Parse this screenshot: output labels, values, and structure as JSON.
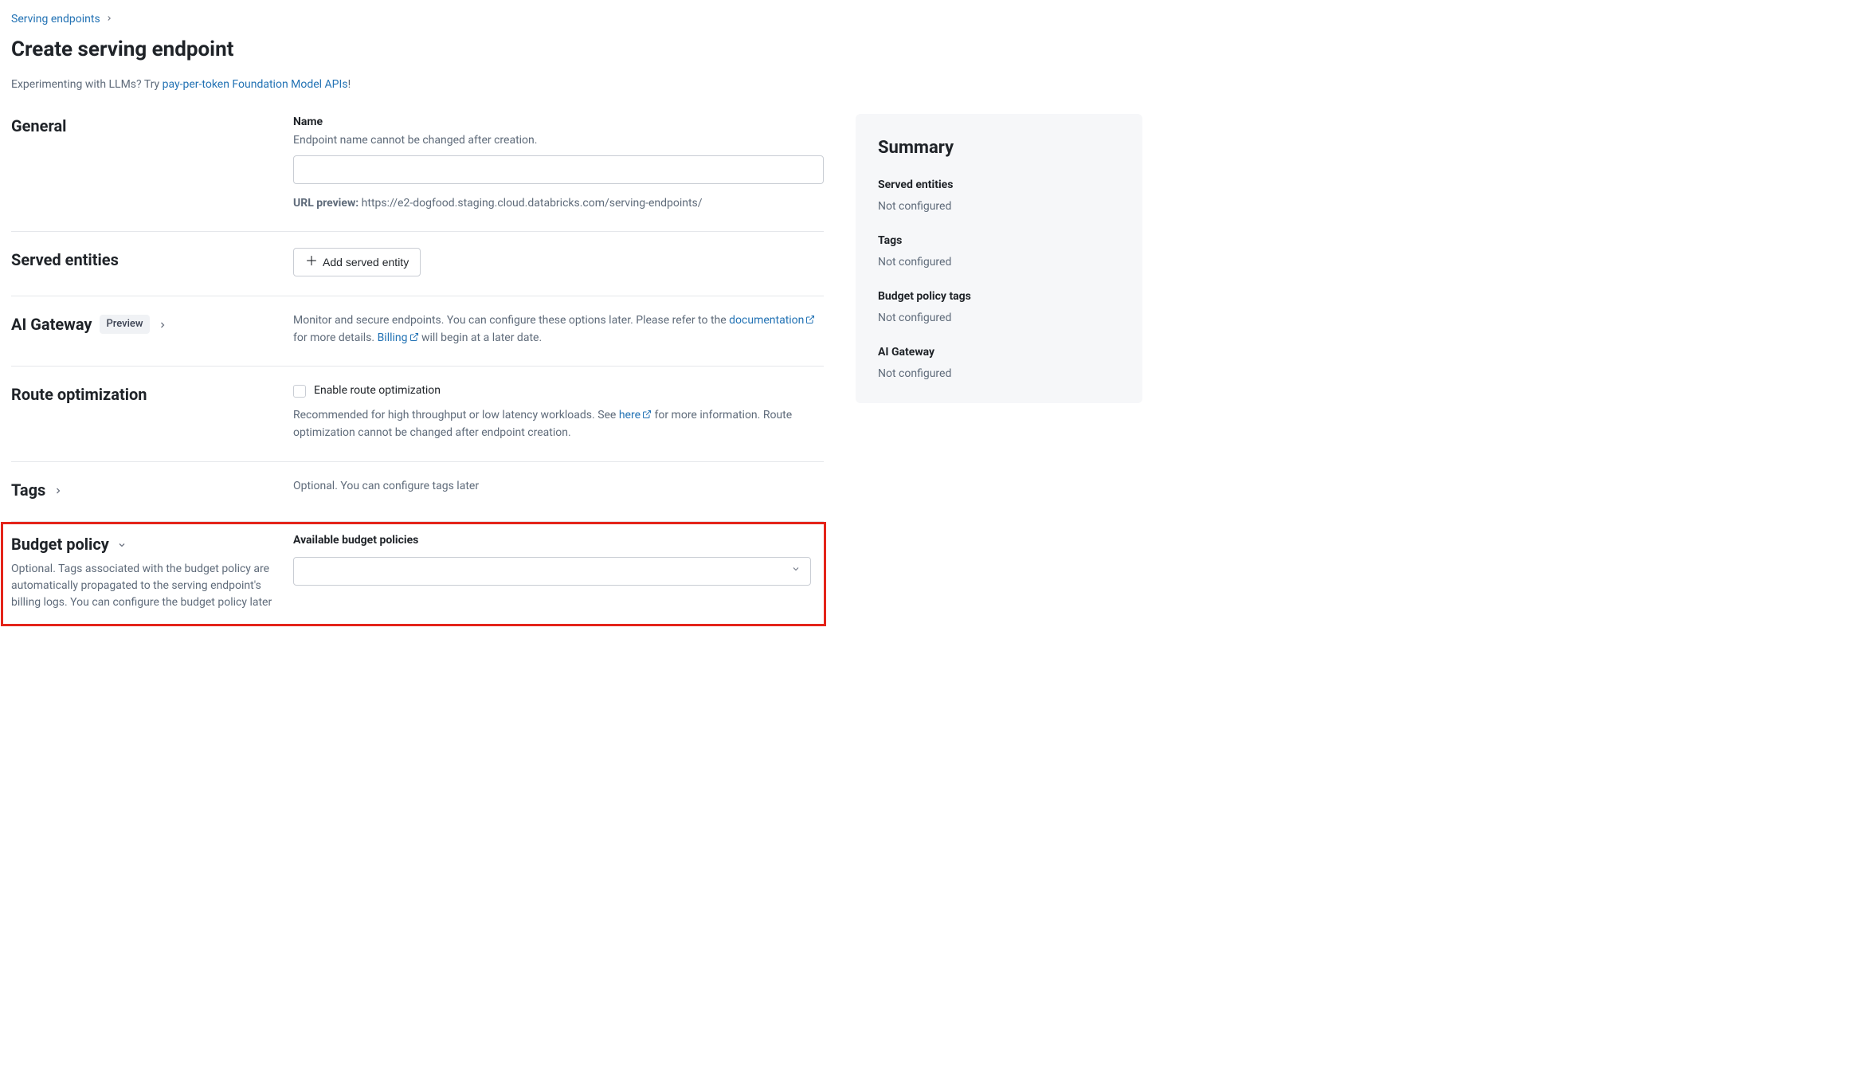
{
  "breadcrumb": {
    "parent": "Serving endpoints"
  },
  "page": {
    "title": "Create serving endpoint",
    "promo_prefix": "Experimenting with LLMs? Try ",
    "promo_link": "pay-per-token Foundation Model APIs",
    "promo_suffix": "!"
  },
  "sections": {
    "general": {
      "heading": "General",
      "name_label": "Name",
      "name_hint": "Endpoint name cannot be changed after creation.",
      "name_value": "",
      "url_preview_label": "URL preview:",
      "url_preview_value": "https://e2-dogfood.staging.cloud.databricks.com/serving-endpoints/"
    },
    "served_entities": {
      "heading": "Served entities",
      "add_button": "Add served entity"
    },
    "ai_gateway": {
      "heading": "AI Gateway",
      "badge": "Preview",
      "desc_1": "Monitor and secure endpoints. You can configure these options later. Please refer to the ",
      "doc_link": "documentation",
      "desc_2": " for more details. ",
      "billing_link": "Billing",
      "desc_3": " will begin at a later date."
    },
    "route_optimization": {
      "heading": "Route optimization",
      "checkbox_label": "Enable route optimization",
      "checkbox_checked": false,
      "desc_1": "Recommended for high throughput or low latency workloads. See ",
      "here_link": "here",
      "desc_2": " for more information. Route optimization cannot be changed after endpoint creation."
    },
    "tags": {
      "heading": "Tags",
      "desc": "Optional. You can configure tags later"
    },
    "budget_policy": {
      "heading": "Budget policy",
      "sub": "Optional. Tags associated with the budget policy are automatically propagated to the serving endpoint's billing logs. You can configure the budget policy later",
      "field_label": "Available budget policies",
      "selected": ""
    }
  },
  "summary": {
    "title": "Summary",
    "items": [
      {
        "label": "Served entities",
        "value": "Not configured"
      },
      {
        "label": "Tags",
        "value": "Not configured"
      },
      {
        "label": "Budget policy tags",
        "value": "Not configured"
      },
      {
        "label": "AI Gateway",
        "value": "Not configured"
      }
    ]
  }
}
